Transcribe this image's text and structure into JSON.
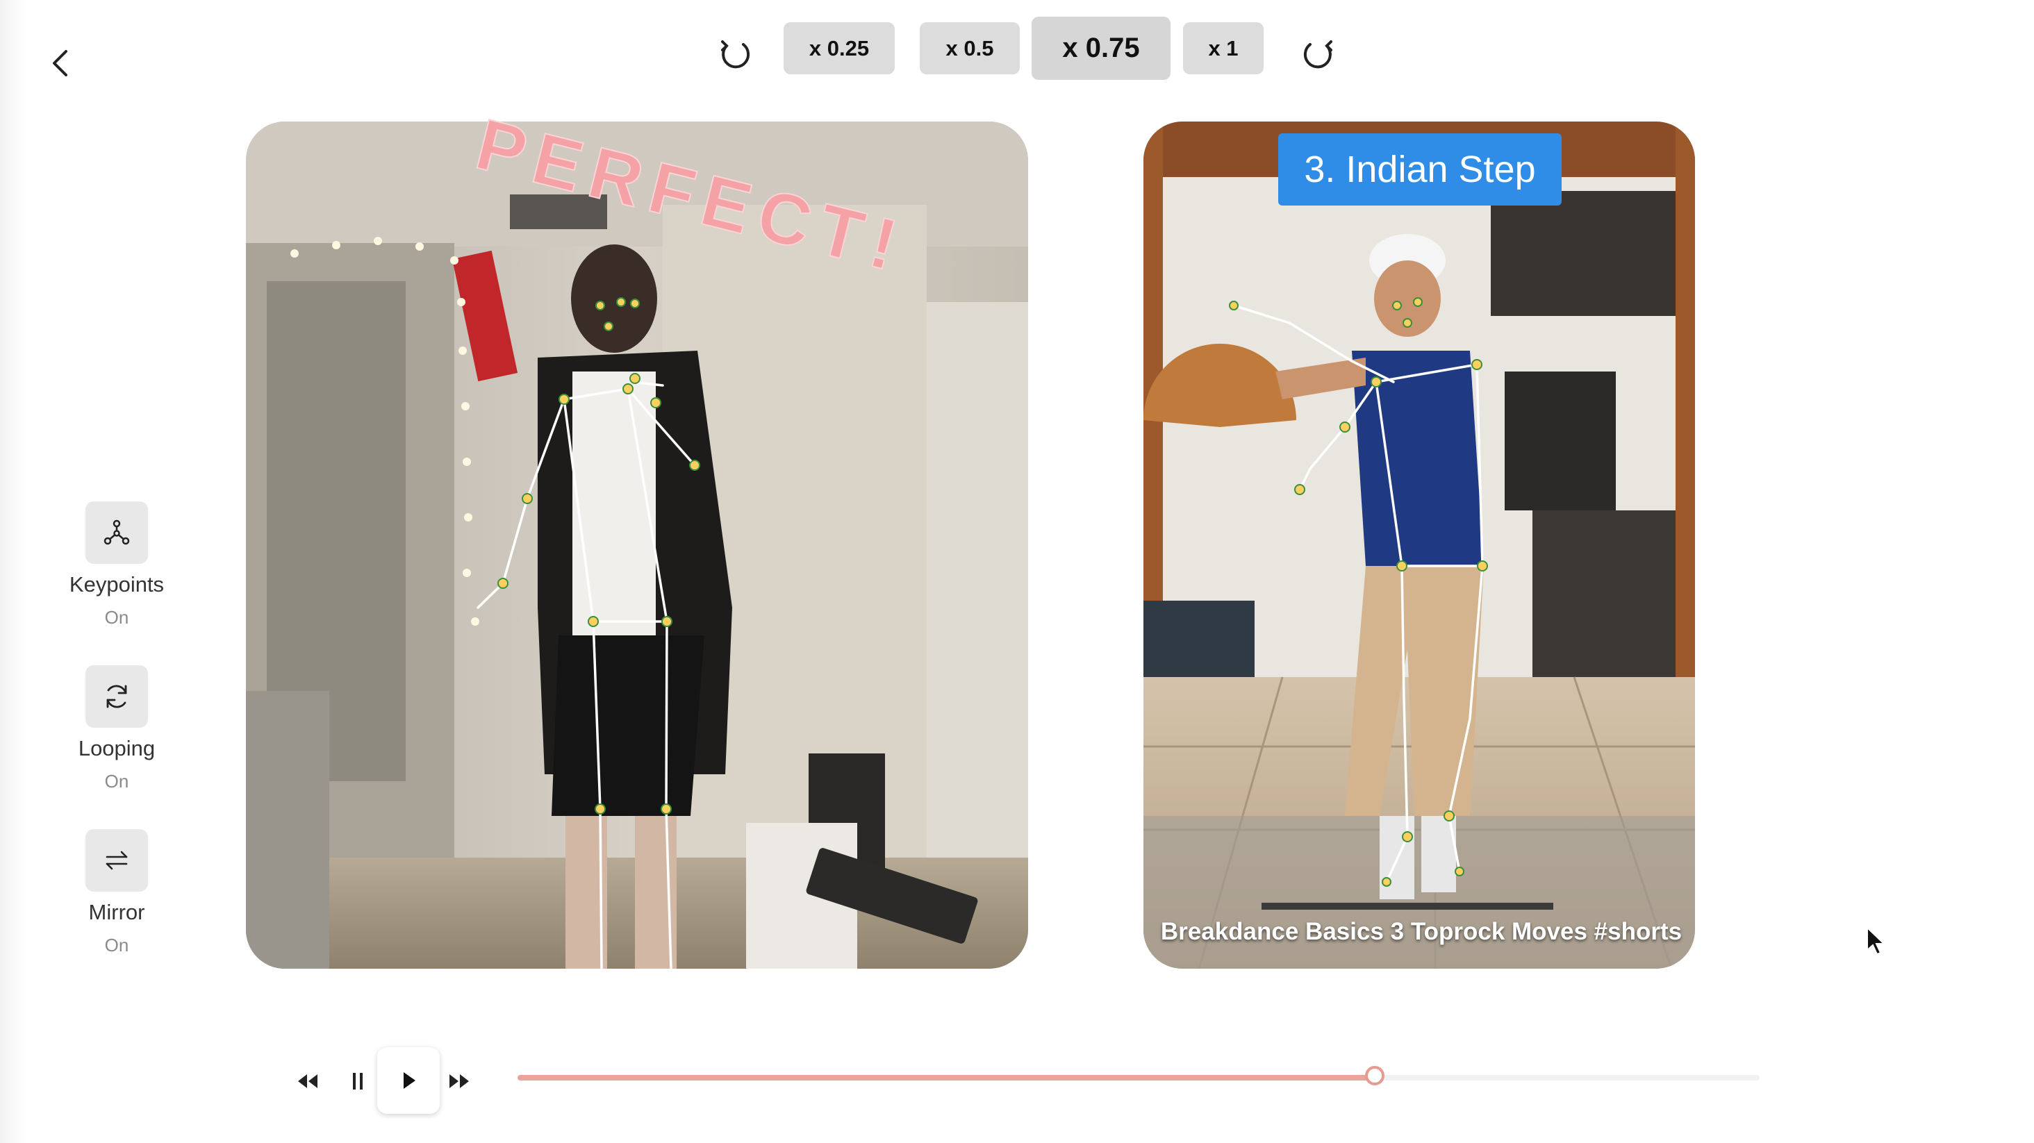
{
  "nav": {
    "back_icon": "chevron-left-icon"
  },
  "speed_bar": {
    "options": [
      "x 0.25",
      "x 0.5",
      "x 0.75",
      "x 1"
    ],
    "selected": "x 0.75",
    "left_icon": "rotate-left-icon",
    "right_icon": "rotate-right-icon"
  },
  "sidebar": {
    "tools": [
      {
        "label": "Keypoints",
        "state": "On",
        "icon": "keypoints-icon"
      },
      {
        "label": "Looping",
        "state": "On",
        "icon": "loop-icon"
      },
      {
        "label": "Mirror",
        "state": "On",
        "icon": "mirror-icon"
      }
    ]
  },
  "user_video": {
    "overlay_text": "PERFECT!"
  },
  "reference_video": {
    "title": "3. Indian Step",
    "caption": "Breakdance Basics 3 Toprock Moves #shorts"
  },
  "player": {
    "progress": 0.69,
    "accent_color": "#eba49a"
  }
}
